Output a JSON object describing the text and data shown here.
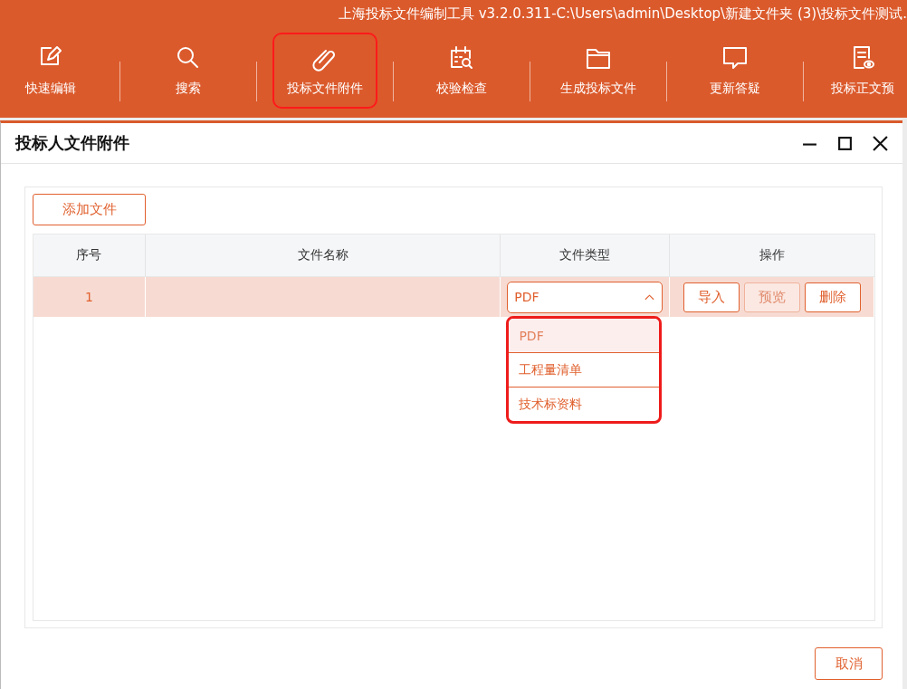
{
  "app_title": "上海投标文件编制工具 v3.2.0.311-C:\\Users\\admin\\Desktop\\新建文件夹 (3)\\投标文件测试.",
  "toolbar": [
    {
      "label": "快速编辑",
      "selected": false
    },
    {
      "label": "搜索",
      "selected": false
    },
    {
      "label": "投标文件附件",
      "selected": true
    },
    {
      "label": "校验检查",
      "selected": false
    },
    {
      "label": "生成投标文件",
      "selected": false
    },
    {
      "label": "更新答疑",
      "selected": false
    },
    {
      "label": "投标正文预",
      "selected": false
    }
  ],
  "dialog": {
    "title": "投标人文件附件",
    "add_button": "添加文件",
    "cancel_button": "取消",
    "table": {
      "columns": [
        "序号",
        "文件名称",
        "文件类型",
        "操作"
      ],
      "rows": [
        {
          "index": "1",
          "type_value": "PDF",
          "dropdown_open": true,
          "options": [
            {
              "label": "PDF",
              "selected": true
            },
            {
              "label": "工程量清单",
              "selected": false
            },
            {
              "label": "技术标资料",
              "selected": false
            }
          ],
          "actions": [
            {
              "label": "导入",
              "disabled": false
            },
            {
              "label": "预览",
              "disabled": true
            },
            {
              "label": "删除",
              "disabled": false
            }
          ]
        }
      ]
    }
  }
}
